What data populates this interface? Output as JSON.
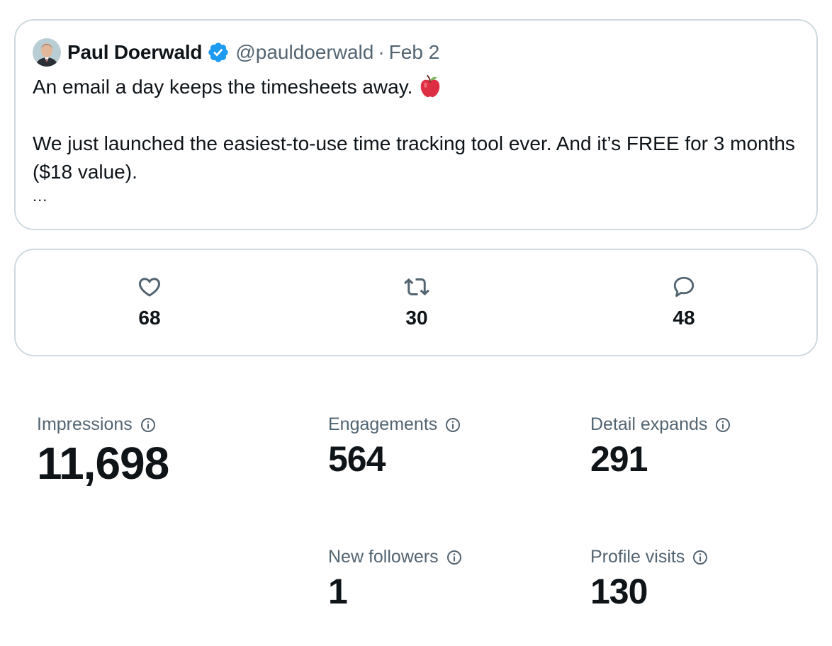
{
  "tweet": {
    "author_name": "Paul Doerwald",
    "handle": "@pauldoerwald",
    "separator": "·",
    "date": "Feb 2",
    "line1": "An email a day keeps the timesheets away.",
    "line2": "We just launched the easiest-to-use time tracking tool ever. And it’s FREE for 3 months ($18 value).",
    "ellipsis": "..."
  },
  "engagement": {
    "likes": "68",
    "reposts": "30",
    "replies": "48"
  },
  "metrics": {
    "impressions": {
      "label": "Impressions",
      "value": "11,698"
    },
    "engagements": {
      "label": "Engagements",
      "value": "564"
    },
    "detail_expands": {
      "label": "Detail expands",
      "value": "291"
    },
    "new_followers": {
      "label": "New followers",
      "value": "1"
    },
    "profile_visits": {
      "label": "Profile visits",
      "value": "130"
    }
  },
  "colors": {
    "text_primary": "#0f1419",
    "text_secondary": "#536471",
    "border": "#cfd9de",
    "verified_blue": "#1d9bf0"
  },
  "icons": {
    "verified": "verified-badge-icon",
    "emoji": "red-apple-emoji",
    "like": "heart-icon",
    "repost": "repost-icon",
    "reply": "reply-bubble-icon",
    "info": "info-circle-icon"
  }
}
